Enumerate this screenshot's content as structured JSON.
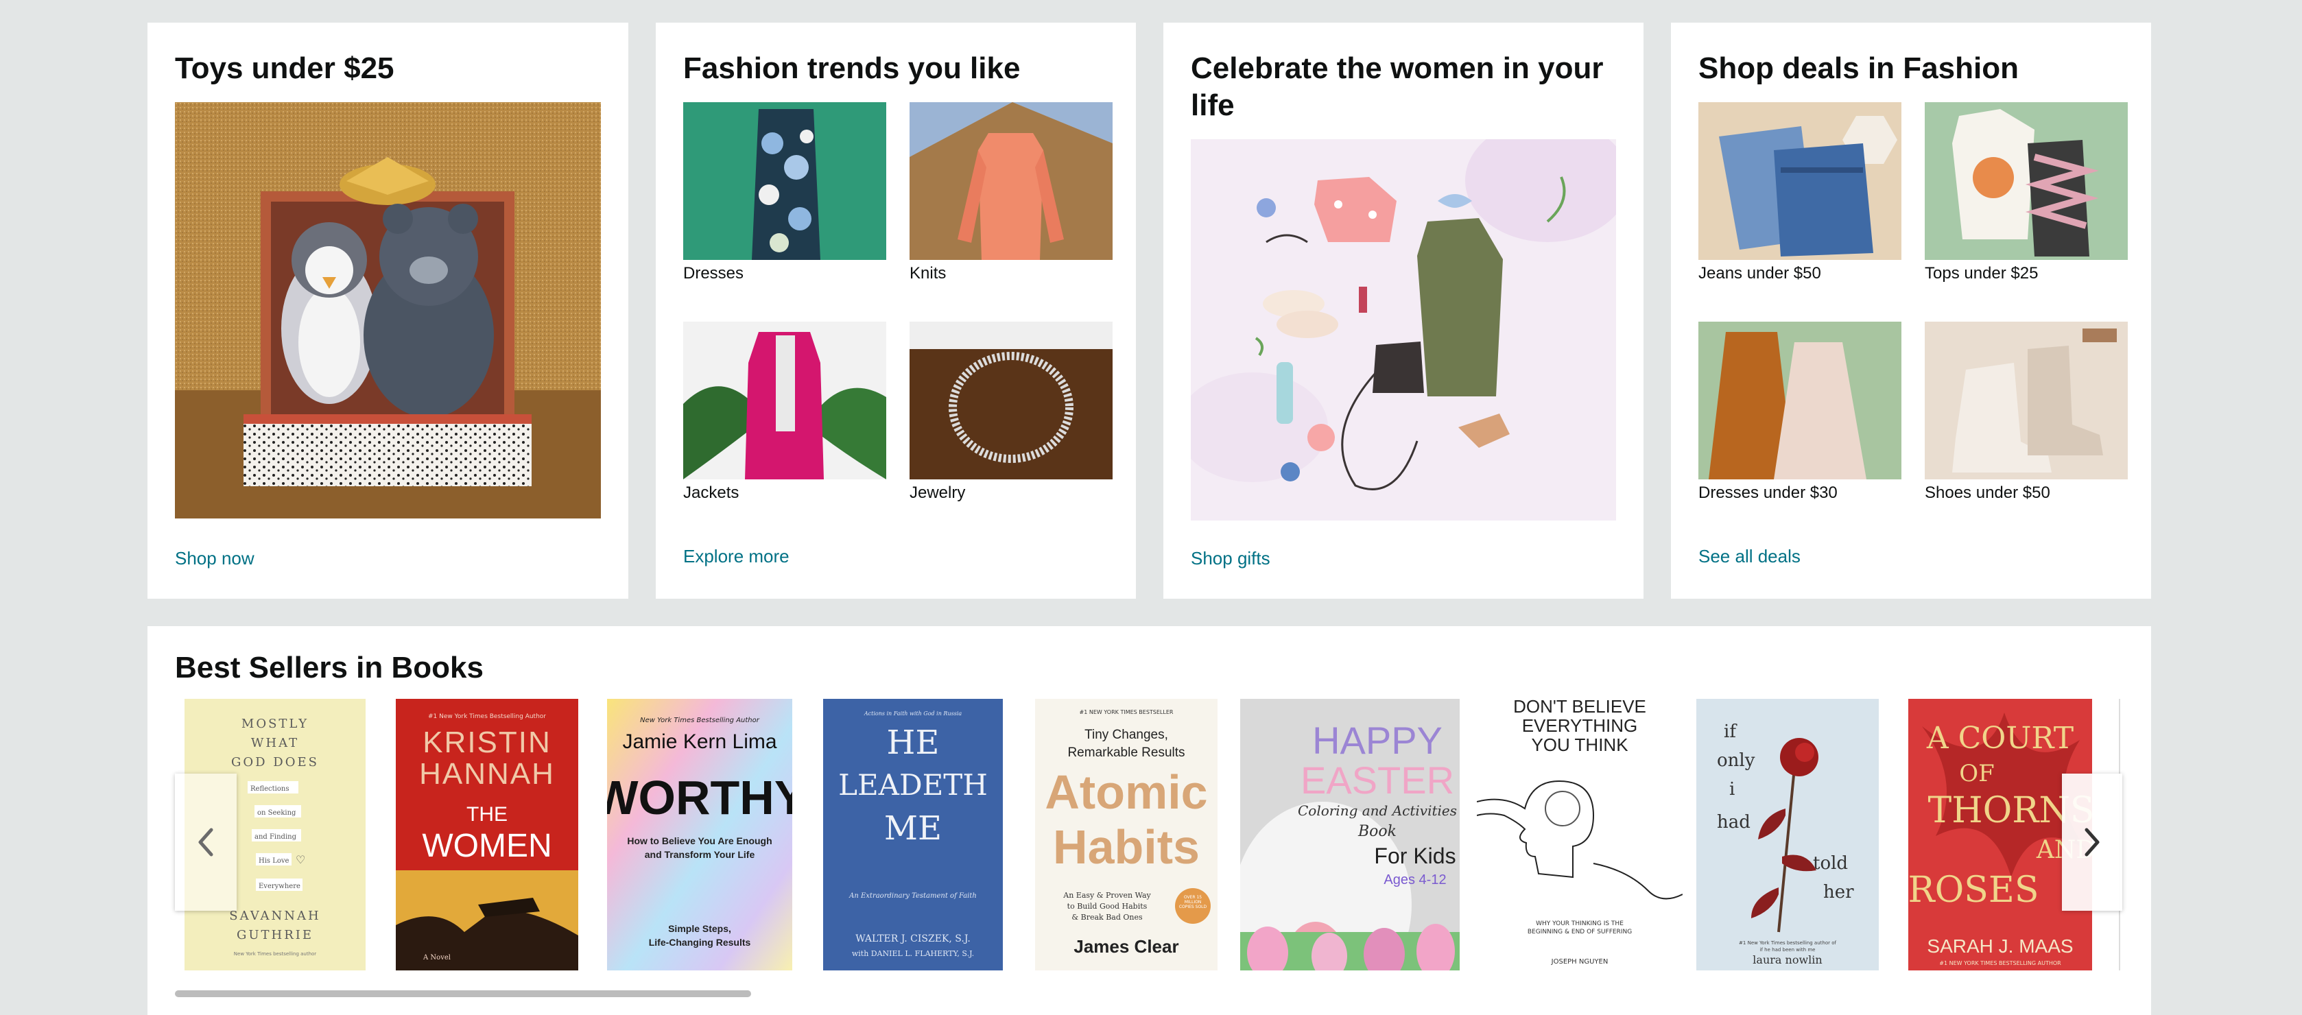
{
  "cards": [
    {
      "title": "Toys under $25",
      "link": "Shop now"
    },
    {
      "title": "Fashion trends you like",
      "link": "Explore more",
      "tiles": [
        {
          "label": "Dresses"
        },
        {
          "label": "Knits"
        },
        {
          "label": "Jackets"
        },
        {
          "label": "Jewelry"
        }
      ]
    },
    {
      "title_line1": "Celebrate the women in your",
      "title_line2": "life",
      "link": "Shop gifts"
    },
    {
      "title": "Shop deals in Fashion",
      "link": "See all deals",
      "tiles": [
        {
          "label": "Jeans under $50"
        },
        {
          "label": "Tops under $25"
        },
        {
          "label": "Dresses under $30"
        },
        {
          "label": "Shoes under $50"
        }
      ]
    }
  ],
  "best_sellers": {
    "title": "Best Sellers in Books",
    "books": [
      {
        "title_lines": [
          "MOSTLY",
          "WHAT",
          "GOD DOES"
        ],
        "author_lines": [
          "SAVANNAH",
          "GUTHRIE"
        ],
        "tagline": "New York Times bestselling author",
        "notes": [
          "Reflections",
          "on Seeking",
          "and Finding",
          "His Love",
          "Everywhere"
        ],
        "bg": "#f3eebd"
      },
      {
        "author_lines": [
          "KRISTIN",
          "HANNAH"
        ],
        "title_lines": [
          "THE",
          "WOMEN"
        ],
        "tagline": "#1 New York Times Bestselling Author",
        "subtitle": "A Novel",
        "bg": "#c8241d"
      },
      {
        "tagline": "New York Times Bestselling Author",
        "author": "Jamie Kern Lima",
        "title": "WORTHY",
        "subtitle_lines": [
          "How to Believe You Are Enough",
          "and Transform Your Life"
        ],
        "footer_lines": [
          "Simple Steps,",
          "Life-Changing Results"
        ],
        "bg": "#e9e4ef"
      },
      {
        "tagline": "Actions in Faith with God in Russia",
        "title_lines": [
          "HE",
          "LEADETH",
          "ME"
        ],
        "subtitle": "An Extraordinary Testament of Faith",
        "author_lines": [
          "WALTER J. CISZEK, S.J.",
          "with DANIEL L. FLAHERTY, S.J."
        ],
        "bg": "#3d63a6"
      },
      {
        "tagline": "#1 NEW YORK TIMES BESTSELLER",
        "subtitle_lines": [
          "Tiny Changes,",
          "Remarkable Results"
        ],
        "title_lines": [
          "Atomic",
          "Habits"
        ],
        "desc_lines": [
          "An Easy & Proven Way",
          "to Build Good Habits",
          "& Break Bad Ones"
        ],
        "badge": "OVER 15 MILLION COPIES SOLD",
        "author": "James Clear",
        "bg": "#f7f4ec"
      },
      {
        "title_lines": [
          "HAPPY",
          "EASTER"
        ],
        "subtitle_lines": [
          "Coloring and Activities",
          "Book",
          "For Kids"
        ],
        "ages": "Ages 4-12",
        "bg": "#d9d9d9"
      },
      {
        "title_lines": [
          "DON'T BELIEVE",
          "EVERYTHING",
          "YOU THINK"
        ],
        "subtitle_lines": [
          "WHY YOUR THINKING IS THE",
          "BEGINNING & END OF SUFFERING"
        ],
        "author": "JOSEPH NGUYEN",
        "bg": "#ffffff"
      },
      {
        "title_lines": [
          "if",
          "only",
          "i",
          "had"
        ],
        "title_lines_right": [
          "told",
          "her"
        ],
        "tagline_lines": [
          "#1 New York Times bestselling author of",
          "if he had been with me"
        ],
        "author": "laura nowlin",
        "bg": "#d8e4ec"
      },
      {
        "title_lines": [
          "A COURT",
          "OF",
          "THORNS",
          "AND",
          "ROSES"
        ],
        "author": "SARAH J. MAAS",
        "tagline": "#1 NEW YORK TIMES BESTSELLING AUTHOR",
        "bg": "#d83a3a"
      }
    ]
  },
  "colors": {
    "page_bg": "#e3e6e6",
    "link": "#007185",
    "text": "#0f1111",
    "card_bg": "#ffffff"
  },
  "icons": {
    "prev": "chevron-left-icon",
    "next": "chevron-right-icon"
  }
}
